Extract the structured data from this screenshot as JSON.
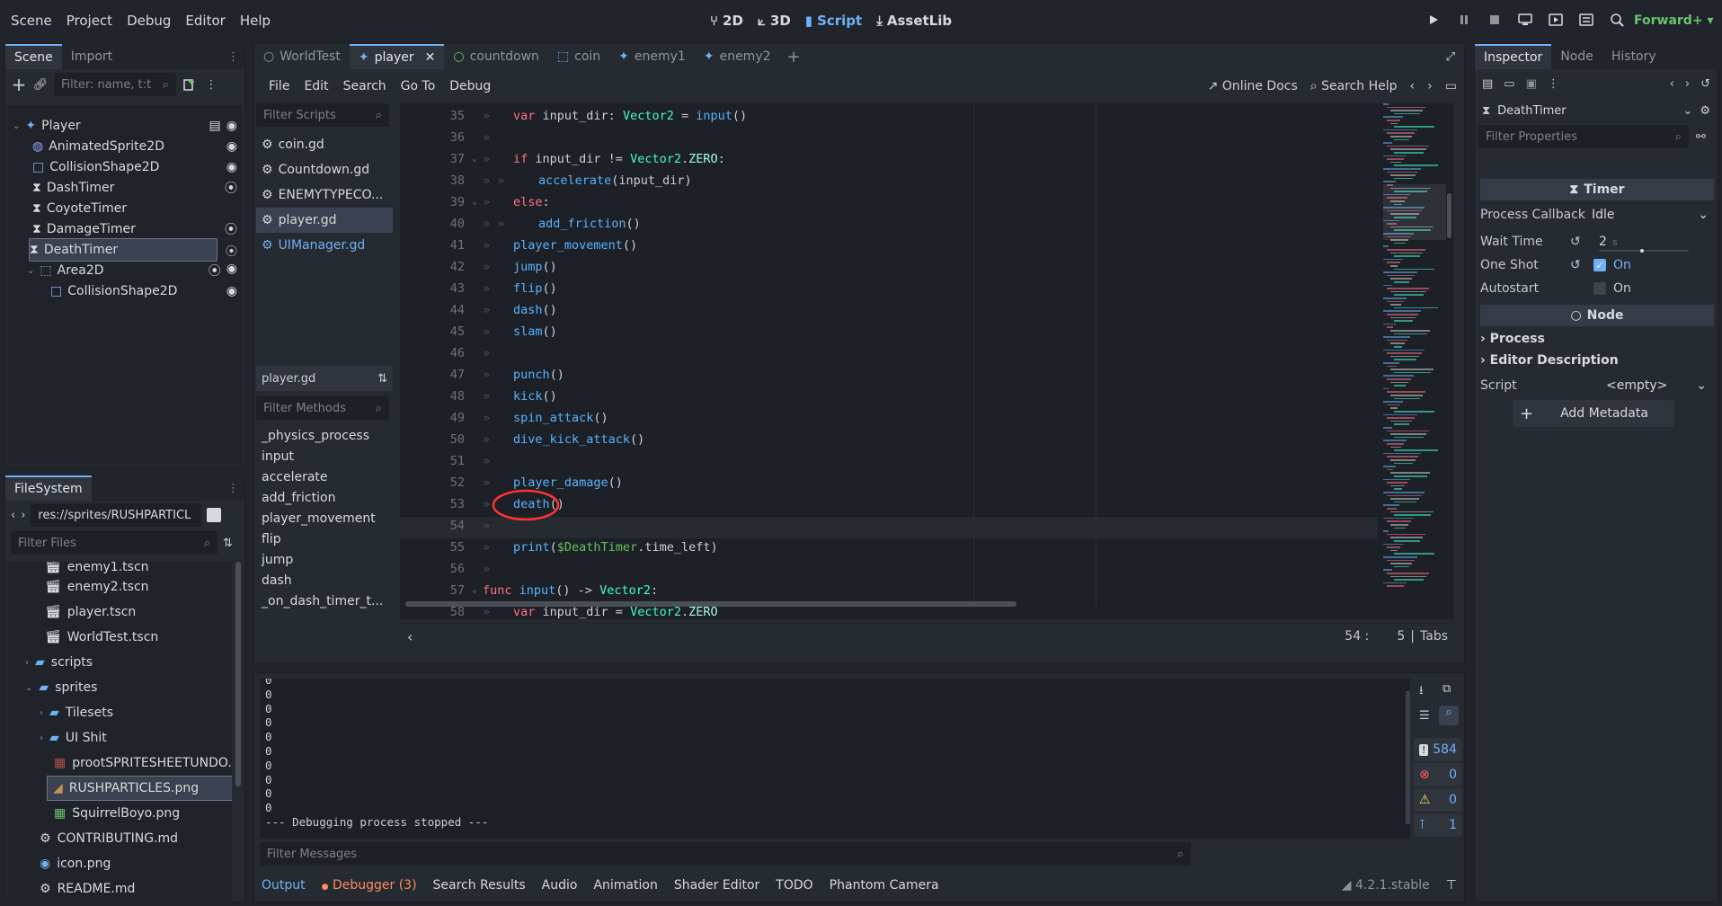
{
  "menu": [
    "Scene",
    "Project",
    "Debug",
    "Editor",
    "Help"
  ],
  "workspaces": [
    {
      "label": "2D",
      "icon": "2d-icon"
    },
    {
      "label": "3D",
      "icon": "3d-icon"
    },
    {
      "label": "Script",
      "icon": "script-icon",
      "active": true
    },
    {
      "label": "AssetLib",
      "icon": "assetlib-icon"
    }
  ],
  "renderer": "Forward+",
  "scene_panel": {
    "tabs": [
      "Scene",
      "Import"
    ],
    "filter_placeholder": "Filter: name, t:t",
    "nodes": [
      {
        "label": "Player",
        "icon": "node-player"
      },
      {
        "label": "AnimatedSprite2D",
        "icon": "sprite"
      },
      {
        "label": "CollisionShape2D",
        "icon": "shape"
      },
      {
        "label": "DashTimer",
        "icon": "timer"
      },
      {
        "label": "CoyoteTimer",
        "icon": "timer"
      },
      {
        "label": "DamageTimer",
        "icon": "timer"
      },
      {
        "label": "DeathTimer",
        "icon": "timer"
      },
      {
        "label": "Area2D",
        "icon": "area"
      },
      {
        "label": "CollisionShape2D",
        "icon": "shape"
      }
    ]
  },
  "filesystem": {
    "tab": "FileSystem",
    "path": "res://sprites/RUSHPARTICL",
    "filter_placeholder": "Filter Files",
    "items": [
      {
        "label": "enemy1.tscn",
        "type": "scene"
      },
      {
        "label": "enemy2.tscn",
        "type": "scene"
      },
      {
        "label": "player.tscn",
        "type": "scene"
      },
      {
        "label": "WorldTest.tscn",
        "type": "scene"
      },
      {
        "label": "scripts",
        "type": "folder"
      },
      {
        "label": "sprites",
        "type": "folder"
      },
      {
        "label": "Tilesets",
        "type": "folder"
      },
      {
        "label": "UI Shit",
        "type": "folder"
      },
      {
        "label": "prootSPRITESHEETUNDO...",
        "type": "image"
      },
      {
        "label": "RUSHPARTICLES.png",
        "type": "image"
      },
      {
        "label": "SquirrelBoyo.png",
        "type": "image"
      },
      {
        "label": "CONTRIBUTING.md",
        "type": "doc"
      },
      {
        "label": "icon.png",
        "type": "image"
      },
      {
        "label": "README.md",
        "type": "doc"
      }
    ]
  },
  "script_tabs": [
    "WorldTest",
    "player",
    "countdown",
    "coin",
    "enemy1",
    "enemy2"
  ],
  "script_menu": [
    "File",
    "Edit",
    "Search",
    "Go To",
    "Debug"
  ],
  "script_menu_right": {
    "docs": "Online Docs",
    "help": "Search Help"
  },
  "scripts_filter": "Filter Scripts",
  "scripts": [
    "coin.gd",
    "Countdown.gd",
    "ENEMYTYPECO...",
    "player.gd",
    "UIManager.gd"
  ],
  "current_script": "player.gd",
  "methods_filter": "Filter Methods",
  "methods": [
    "_physics_process",
    "input",
    "accelerate",
    "add_friction",
    "player_movement",
    "flip",
    "jump",
    "dash",
    "_on_dash_timer_t..."
  ],
  "code": [
    {
      "n": "35",
      "text": "var input_dir: Vector2 = input()"
    },
    {
      "n": "36",
      "text": ""
    },
    {
      "n": "37",
      "text": "if input_dir != Vector2.ZERO:"
    },
    {
      "n": "38",
      "text": "accelerate(input_dir)"
    },
    {
      "n": "39",
      "text": "else:"
    },
    {
      "n": "40",
      "text": "add_friction()"
    },
    {
      "n": "41",
      "text": "player_movement()"
    },
    {
      "n": "42",
      "text": "jump()"
    },
    {
      "n": "43",
      "text": "flip()"
    },
    {
      "n": "44",
      "text": "dash()"
    },
    {
      "n": "45",
      "text": "slam()"
    },
    {
      "n": "46",
      "text": ""
    },
    {
      "n": "47",
      "text": "punch()"
    },
    {
      "n": "48",
      "text": "kick()"
    },
    {
      "n": "49",
      "text": "spin_attack()"
    },
    {
      "n": "50",
      "text": "dive_kick_attack()"
    },
    {
      "n": "51",
      "text": ""
    },
    {
      "n": "52",
      "text": "player_damage()"
    },
    {
      "n": "53",
      "text": "death()"
    },
    {
      "n": "54",
      "text": ""
    },
    {
      "n": "55",
      "text": "print($DeathTimer.time_left)"
    },
    {
      "n": "56",
      "text": ""
    },
    {
      "n": "57",
      "text": "func input() -> Vector2:"
    },
    {
      "n": "58",
      "text": "var input_dir = Vector2.ZERO"
    }
  ],
  "cursor": {
    "line": "54 :",
    "col": "5",
    "indent": "Tabs"
  },
  "output": {
    "lines": [
      "0",
      "0",
      "0",
      "0",
      "0",
      "0",
      "0",
      "0",
      "0",
      "0",
      "--- Debugging process stopped ---"
    ],
    "filter_placeholder": "Filter Messages",
    "counts": {
      "messages": "584",
      "errors": "0",
      "warnings": "0",
      "editor": "1"
    }
  },
  "bottom_tabs": [
    "Output",
    "Debugger (3)",
    "Search Results",
    "Audio",
    "Animation",
    "Shader Editor",
    "TODO",
    "Phantom Camera"
  ],
  "version": "4.2.1.stable",
  "inspector": {
    "tabs": [
      "Inspector",
      "Node",
      "History"
    ],
    "object": "DeathTimer",
    "filter_placeholder": "Filter Properties",
    "section_timer": "Timer",
    "props": {
      "process_callback": {
        "label": "Process Callback",
        "value": "Idle"
      },
      "wait_time": {
        "label": "Wait Time",
        "value": "2",
        "unit": "s"
      },
      "one_shot": {
        "label": "One Shot",
        "value": "On",
        "checked": true
      },
      "autostart": {
        "label": "Autostart",
        "value": "On",
        "checked": false
      }
    },
    "section_node": "Node",
    "groups": [
      "Process",
      "Editor Description"
    ],
    "script": {
      "label": "Script",
      "value": "<empty>"
    },
    "add_metadata": "Add Metadata"
  },
  "colors": {
    "accent": "#6fb1f5",
    "keyword": "#ff7085",
    "function": "#57b3ff",
    "type": "#42ffc2",
    "annotation": "#ff3333"
  }
}
